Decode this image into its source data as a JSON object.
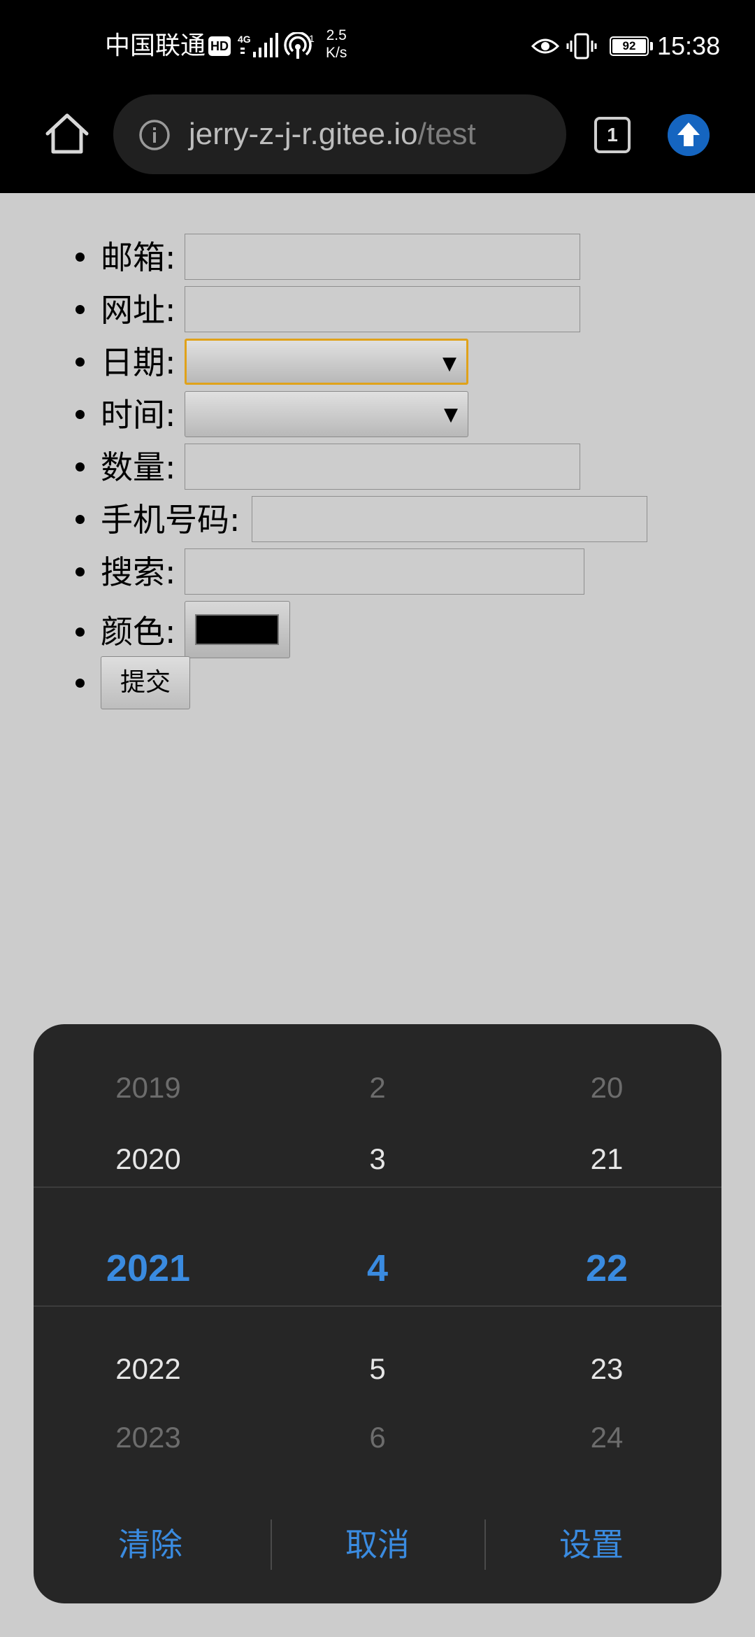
{
  "status_bar": {
    "carrier": "中国联通",
    "hd_badge": "HD",
    "network_type": "4G",
    "hotspot_count": "1",
    "speed_value": "2.5",
    "speed_unit": "K/s",
    "battery_level": "92",
    "time": "15:38"
  },
  "browser": {
    "url_host": "jerry-z-j-r.gitee.io",
    "url_path": "/test",
    "tab_count": "1"
  },
  "form": {
    "email_label": "邮箱:",
    "url_label": "网址:",
    "date_label": "日期:",
    "time_label": "时间:",
    "number_label": "数量:",
    "phone_label": "手机号码:",
    "search_label": "搜索:",
    "color_label": "颜色:",
    "color_value": "#000000",
    "submit_label": "提交"
  },
  "picker": {
    "years": [
      "2019",
      "2020",
      "2021",
      "2022",
      "2023"
    ],
    "months": [
      "2",
      "3",
      "4",
      "5",
      "6"
    ],
    "days": [
      "20",
      "21",
      "22",
      "23",
      "24"
    ],
    "selected_index": 2,
    "clear_label": "清除",
    "cancel_label": "取消",
    "set_label": "设置",
    "accent_color": "#3a8be0"
  }
}
